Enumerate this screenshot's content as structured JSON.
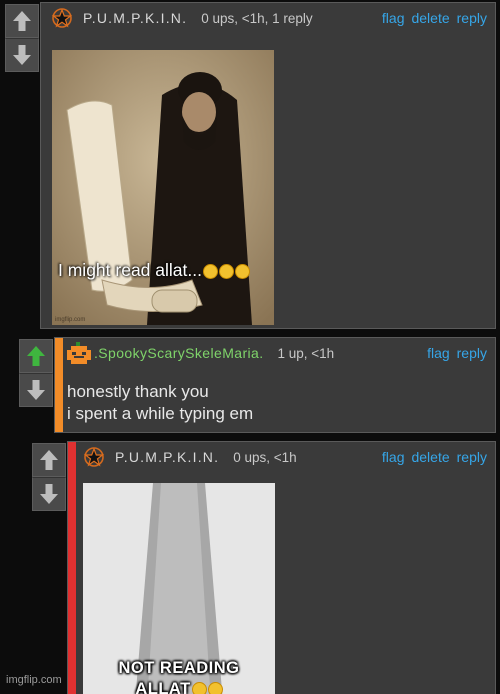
{
  "comments": [
    {
      "username": "P.U.M.P.K.I.N.",
      "meta": "0 ups, <1h, 1 reply",
      "actions": [
        "flag",
        "delete",
        "reply"
      ],
      "image_caption": "I might read allat...",
      "image_watermark": "imgflip.com",
      "avatar_icon": "star-pentagram-icon"
    },
    {
      "username": ".SpookyScarySkeleMaria.",
      "meta": "1 up, <1h",
      "actions": [
        "flag",
        "reply"
      ],
      "body_lines": [
        "honestly thank you",
        "i spent a while typing em"
      ],
      "upvoted_color": "#3fb63f",
      "stripe_color": "#f28c28",
      "avatar_icon": "pixel-pumpkin-icon"
    },
    {
      "username": "P.U.M.P.K.I.N.",
      "meta": "0 ups, <1h",
      "actions": [
        "flag",
        "delete",
        "reply"
      ],
      "image_caption_line1": "NOT READING",
      "image_caption_line2": "ALLAT",
      "stripe_color": "#e03131",
      "avatar_icon": "star-pentagram-icon"
    }
  ],
  "watermark": "imgflip.com",
  "colors": {
    "link": "#36a6e8",
    "background": "#0c0c0c",
    "panel": "#3a3a3a"
  }
}
